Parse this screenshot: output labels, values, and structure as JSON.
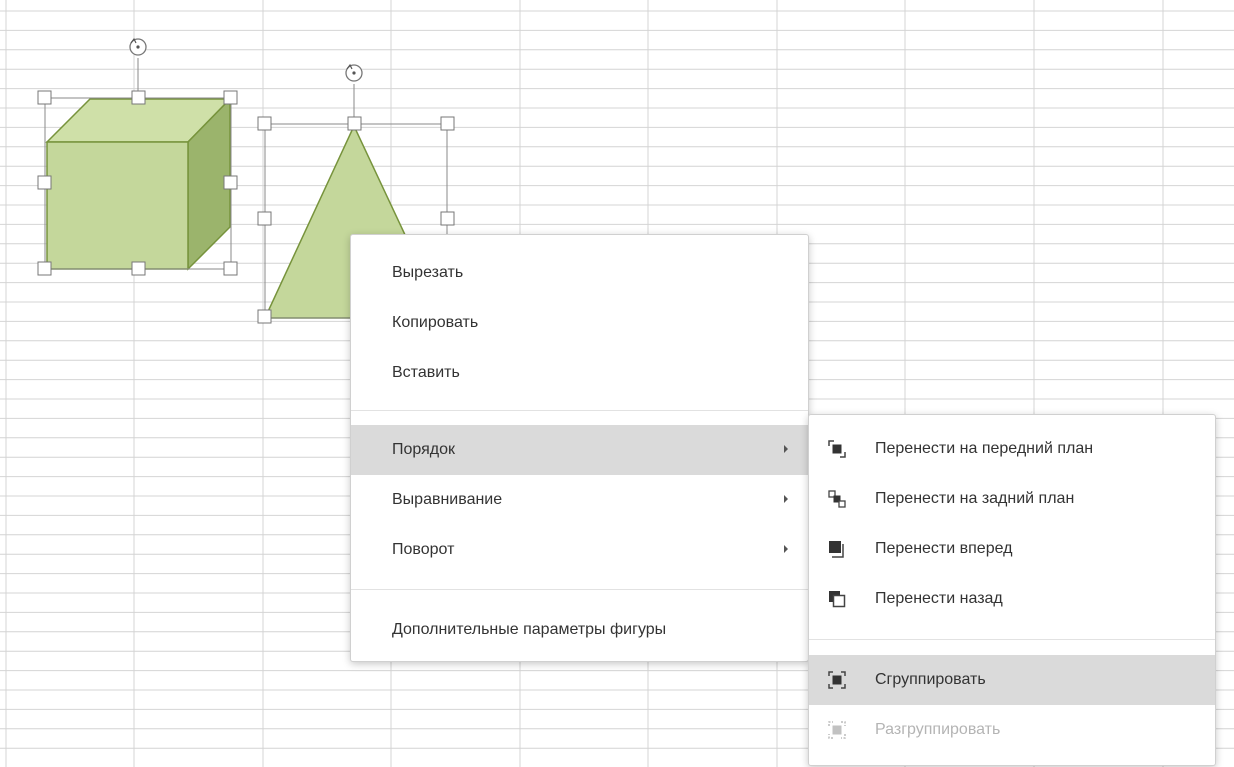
{
  "context_menu": {
    "cut": "Вырезать",
    "copy": "Копировать",
    "paste": "Вставить",
    "order": "Порядок",
    "align": "Выравнивание",
    "rotate": "Поворот",
    "advanced": "Дополнительные параметры фигуры"
  },
  "order_submenu": {
    "bring_front": "Перенести на передний план",
    "send_back": "Перенести на задний план",
    "bring_forward": "Перенести вперед",
    "send_backward": "Перенести назад",
    "group": "Сгруппировать",
    "ungroup": "Разгруппировать"
  },
  "colors": {
    "shape_fill": "#c4d79b",
    "shape_side": "#9bb46c",
    "shape_stroke": "#77933c",
    "active_row": "#dadada",
    "disabled_text": "#b4b4b4"
  },
  "icons": [
    "bring-to-front-icon",
    "send-to-back-icon",
    "bring-forward-icon",
    "send-backward-icon",
    "group-icon",
    "ungroup-icon"
  ]
}
